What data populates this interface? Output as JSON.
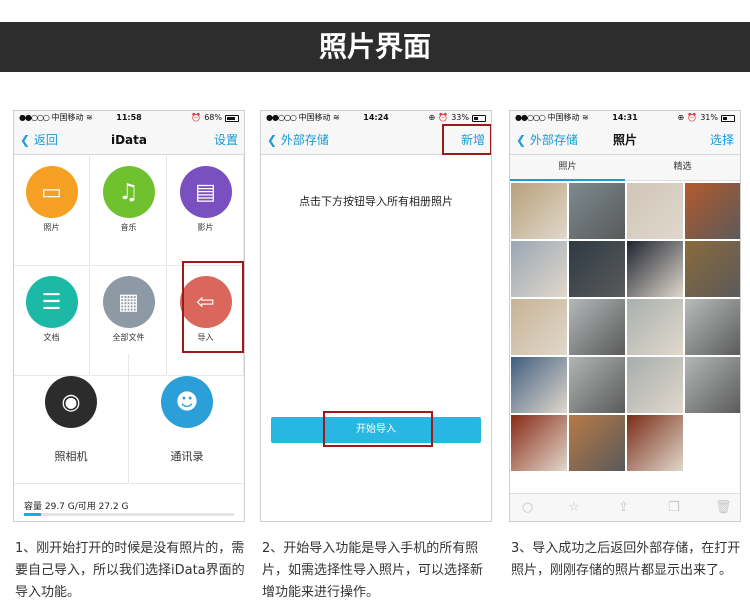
{
  "banner": {
    "title": "照片界面"
  },
  "phone1": {
    "status": {
      "carrier": "中国移动",
      "time": "11:58",
      "battery": "68%",
      "battery_level": 0.68
    },
    "nav": {
      "back": "返回",
      "title": "iData",
      "right": "设置"
    },
    "apps": [
      {
        "label": "照片",
        "icon": "photo-icon",
        "color": "#f5a023"
      },
      {
        "label": "音乐",
        "icon": "music-icon",
        "color": "#6fc22d"
      },
      {
        "label": "影片",
        "icon": "clapper-icon",
        "color": "#7a4fbf"
      },
      {
        "label": "文档",
        "icon": "document-icon",
        "color": "#1bb9a6"
      },
      {
        "label": "全部文件",
        "icon": "grid-icon",
        "color": "#8d9aa6"
      },
      {
        "label": "导入",
        "icon": "import-icon",
        "color": "#d9675c"
      }
    ],
    "big_apps": [
      {
        "label": "照相机",
        "icon": "camera-icon",
        "color": "#2c2c2c"
      },
      {
        "label": "通讯录",
        "icon": "contacts-icon",
        "color": "#2a9fd8"
      }
    ],
    "storage": {
      "text": "容量 29.7 G/可用 27.2 G",
      "used_fraction": 0.08
    }
  },
  "phone2": {
    "status": {
      "carrier": "中国移动",
      "time": "14:24",
      "battery": "33%",
      "battery_level": 0.33
    },
    "nav": {
      "back": "外部存储",
      "right": "新增"
    },
    "hint": "点击下方按钮导入所有相册照片",
    "start_button": "开始导入"
  },
  "phone3": {
    "status": {
      "carrier": "中国移动",
      "time": "14:31",
      "battery": "31%",
      "battery_level": 0.31
    },
    "nav": {
      "back": "外部存储",
      "title": "照片",
      "right": "选择"
    },
    "tabs": [
      "照片",
      "精选"
    ],
    "photo_colors": [
      "#b9a07a",
      "#7c8a8f",
      "#cfc5b8",
      "#b45a2c",
      "#9aa6b3",
      "#2e3a44",
      "#1e2430",
      "#8b6a3c",
      "#c8b395",
      "#b3b8b8",
      "#a9b0ae",
      "#b9bcbc",
      "#3f5f80",
      "#b0b6b3",
      "#a7adad",
      "#b2b7b5",
      "#8a2a16",
      "#b77a46",
      "#7a2c16"
    ]
  },
  "captions": [
    "1、刚开始打开的时候是没有照片的，需要自己导入，所以我们选择iData界面的导入功能。",
    "2、开始导入功能是导入手机的所有照片，如需选择性导入照片，可以选择新增功能来进行操作。",
    "3、导入成功之后返回外部存储，在打开照片，刚刚存储的照片都显示出来了。"
  ]
}
